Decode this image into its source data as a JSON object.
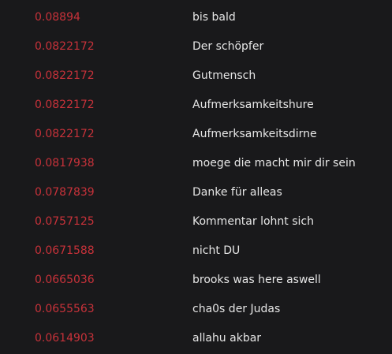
{
  "results": [
    {
      "score": "0.08894",
      "text": "bis bald"
    },
    {
      "score": "0.0822172",
      "text": "Der schöpfer"
    },
    {
      "score": "0.0822172",
      "text": "Gutmensch"
    },
    {
      "score": "0.0822172",
      "text": "Aufmerksamkeitshure"
    },
    {
      "score": "0.0822172",
      "text": "Aufmerksamkeitsdirne"
    },
    {
      "score": "0.0817938",
      "text": "moege die macht mir dir sein"
    },
    {
      "score": "0.0787839",
      "text": "Danke für alleas"
    },
    {
      "score": "0.0757125",
      "text": "Kommentar lohnt sich"
    },
    {
      "score": "0.0671588",
      "text": "nicht DU"
    },
    {
      "score": "0.0665036",
      "text": "brooks was here aswell"
    },
    {
      "score": "0.0655563",
      "text": "cha0s der Judas"
    },
    {
      "score": "0.0614903",
      "text": "allahu akbar"
    }
  ],
  "colors": {
    "background": "#19191b",
    "score": "#c8323a",
    "text": "#e6e6e6"
  }
}
